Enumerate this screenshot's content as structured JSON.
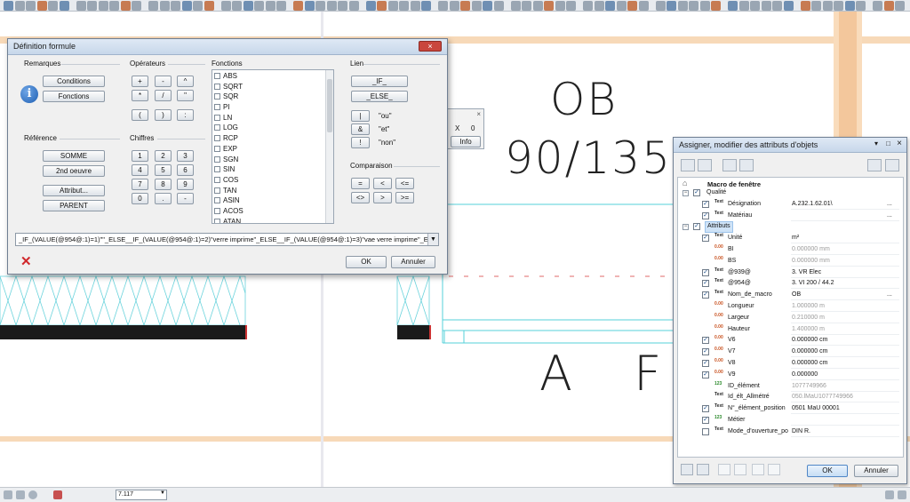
{
  "cad": {
    "label_top1": "OB",
    "label_top2": "90/135",
    "label_bottom": "A F",
    "mini_panel": {
      "x_label": "X",
      "x_value": "0",
      "info_label": "Info"
    }
  },
  "status": {
    "scale_value": "7.117"
  },
  "formula_dialog": {
    "title": "Définition formule",
    "groups": {
      "remarques": "Remarques",
      "operateurs": "Opérateurs",
      "fonctions": "Fonctions",
      "lien": "Lien",
      "reference": "Référence",
      "chiffres": "Chiffres",
      "comparaison": "Comparaison"
    },
    "remarques_buttons": [
      "Conditions",
      "Fonctions"
    ],
    "reference_buttons": [
      "SOMME",
      "2nd oeuvre",
      "Attribut...",
      "PARENT"
    ],
    "operators": [
      "+",
      "-",
      "^",
      "*",
      "/",
      "\"",
      "(",
      ")",
      ":"
    ],
    "digits": [
      "1",
      "2",
      "3",
      "4",
      "5",
      "6",
      "7",
      "8",
      "9",
      "0",
      ".",
      "-"
    ],
    "functions": [
      "ABS",
      "SQRT",
      "SQR",
      "PI",
      "LN",
      "LOG",
      "RCP",
      "EXP",
      "SGN",
      "SIN",
      "COS",
      "TAN",
      "ASIN",
      "ACOS",
      "ATAN"
    ],
    "lien_buttons": [
      "_IF_",
      "_ELSE_"
    ],
    "logic": [
      {
        "symbol": "|",
        "label": "\"ou\""
      },
      {
        "symbol": "&",
        "label": "\"et\""
      },
      {
        "symbol": "!",
        "label": "\"non\""
      }
    ],
    "comparison": [
      "=",
      "<",
      "<=",
      "<>",
      ">",
      ">="
    ],
    "formula": "_IF_(VALUE(@954@:1)=1)\"\"_ELSE__IF_(VALUE(@954@:1)=2)\"verre imprime\"_ELSE__IF_(VALUE(@954@:1)=3)\"vae verre imprime\"_ELSE_",
    "ok": "OK",
    "cancel": "Annuler"
  },
  "attr_panel": {
    "title": "Assigner, modifier des attributs d'objets",
    "root": "Macro de fenêtre",
    "rows": [
      {
        "type": "group",
        "label": "Qualité",
        "checked": true
      },
      {
        "type": "attr",
        "icon": "text",
        "label": "Désignation",
        "value": "A.232.1.62.01\\",
        "checked": true,
        "gray": false,
        "more": true
      },
      {
        "type": "attr",
        "icon": "text",
        "label": "Matériau",
        "value": "",
        "checked": true,
        "gray": false,
        "more": true
      },
      {
        "type": "group",
        "label": "Attributs",
        "checked": true,
        "highlight": true
      },
      {
        "type": "attr",
        "icon": "text",
        "label": "Unité",
        "value": "m²",
        "checked": true,
        "gray": false,
        "more": false
      },
      {
        "type": "attr",
        "icon": "num",
        "label": "BI",
        "value": "0.000000 mm",
        "checked": false,
        "gray": true,
        "more": false
      },
      {
        "type": "attr",
        "icon": "num",
        "label": "BS",
        "value": "0.000000 mm",
        "checked": false,
        "gray": true,
        "more": false
      },
      {
        "type": "attr",
        "icon": "text",
        "label": "@939@",
        "value": "3. VR Elec",
        "checked": true,
        "gray": false,
        "more": false
      },
      {
        "type": "attr",
        "icon": "text",
        "label": "@954@",
        "value": "3. VI 200 / 44.2",
        "checked": true,
        "gray": false,
        "more": false
      },
      {
        "type": "attr",
        "icon": "text",
        "label": "Nom_de_macro",
        "value": "OB",
        "checked": true,
        "gray": false,
        "more": true
      },
      {
        "type": "attr",
        "icon": "num",
        "label": "Longueur",
        "value": "1.000000 m",
        "checked": false,
        "gray": true,
        "more": false
      },
      {
        "type": "attr",
        "icon": "num",
        "label": "Largeur",
        "value": "0.210000 m",
        "checked": false,
        "gray": true,
        "more": false
      },
      {
        "type": "attr",
        "icon": "num",
        "label": "Hauteur",
        "value": "1.400000 m",
        "checked": false,
        "gray": true,
        "more": false
      },
      {
        "type": "attr",
        "icon": "num",
        "label": "V6",
        "value": "0.000000 cm",
        "checked": true,
        "gray": false,
        "more": false
      },
      {
        "type": "attr",
        "icon": "num",
        "label": "V7",
        "value": "0.000000 cm",
        "checked": true,
        "gray": false,
        "more": false
      },
      {
        "type": "attr",
        "icon": "num",
        "label": "V8",
        "value": "0.000000 cm",
        "checked": true,
        "gray": false,
        "more": false
      },
      {
        "type": "attr",
        "icon": "num",
        "label": "V9",
        "value": "0.000000",
        "checked": true,
        "gray": false,
        "more": false
      },
      {
        "type": "attr",
        "icon": "int",
        "label": "ID_élément",
        "value": "1077749966",
        "checked": false,
        "gray": true,
        "more": false
      },
      {
        "type": "attr",
        "icon": "text",
        "label": "Id_élt_Allmétré",
        "value": "050.lMaU1077749966",
        "checked": false,
        "gray": true,
        "more": false
      },
      {
        "type": "attr",
        "icon": "text",
        "label": "N°_élément_position",
        "value": "0501 MaU 00001",
        "checked": true,
        "gray": false,
        "more": false
      },
      {
        "type": "attr",
        "icon": "int",
        "label": "Métier",
        "value": "",
        "checked": true,
        "gray": false,
        "more": false
      },
      {
        "type": "attr",
        "icon": "text",
        "label": "Mode_d'ouverture_po",
        "value": "DIN R.",
        "checked": false,
        "gray": false,
        "more": false
      }
    ],
    "ok": "OK",
    "cancel": "Annuler"
  }
}
